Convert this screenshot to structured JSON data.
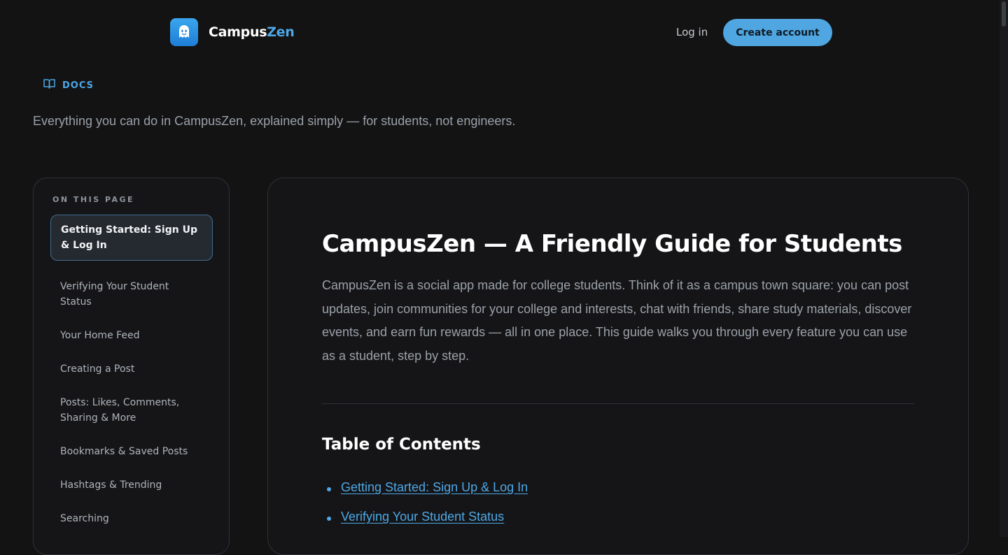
{
  "header": {
    "brand_main": "Campus",
    "brand_accent": "Zen",
    "login_label": "Log in",
    "cta_label": "Create account"
  },
  "docs": {
    "eyebrow": "DOCS",
    "intro": "Everything you can do in CampusZen, explained simply — for students, not engineers."
  },
  "sidebar": {
    "heading": "ON THIS PAGE",
    "items": [
      {
        "label": "Getting Started: Sign Up & Log In",
        "active": true
      },
      {
        "label": "Verifying Your Student Status"
      },
      {
        "label": "Your Home Feed"
      },
      {
        "label": "Creating a Post"
      },
      {
        "label": "Posts: Likes, Comments, Sharing & More"
      },
      {
        "label": "Bookmarks & Saved Posts"
      },
      {
        "label": "Hashtags & Trending"
      },
      {
        "label": "Searching"
      }
    ]
  },
  "article": {
    "title": "CampusZen — A Friendly Guide for Students",
    "lead": "CampusZen is a social app made for college students. Think of it as a campus town square: you can post updates, join communities for your college and interests, chat with friends, share study materials, discover events, and earn fun rewards — all in one place. This guide walks you through every feature you can use as a student, step by step.",
    "toc_heading": "Table of Contents",
    "toc_links": [
      "Getting Started: Sign Up & Log In",
      "Verifying Your Student Status"
    ]
  },
  "colors": {
    "accent": "#4ea8e6",
    "background": "#131314",
    "card": "#151517"
  },
  "icons": {
    "logo": "ghost-face-icon",
    "docs": "open-book-icon"
  }
}
